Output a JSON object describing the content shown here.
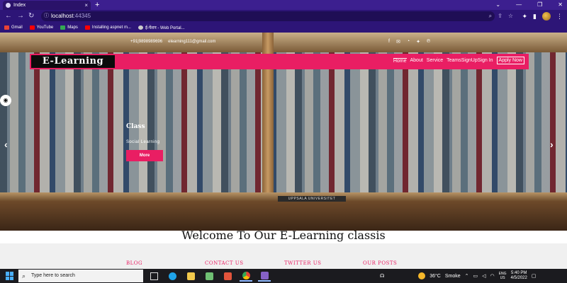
{
  "browser": {
    "tab_title": "Index",
    "tab_close": "×",
    "new_tab": "+",
    "window_controls": [
      "⌄",
      "—",
      "❐",
      "✕"
    ],
    "url_host": "localhost",
    "url_port": ":44345",
    "bookmarks": [
      {
        "label": "Gmail",
        "icon": "gmail-icon",
        "color": "#ea4335"
      },
      {
        "label": "YouTube",
        "icon": "youtube-icon",
        "color": "#ff0000"
      },
      {
        "label": "Maps",
        "icon": "maps-icon",
        "color": "#34a853"
      },
      {
        "label": "Installing aspnet m...",
        "icon": "youtube-icon",
        "color": "#ff0000"
      },
      {
        "label": "ई-पेंशन - Web Portal...",
        "icon": "portal-icon",
        "color": "#cccccc"
      }
    ]
  },
  "site": {
    "contact_phone": "+91|9898989696",
    "contact_email": "elearning111@gmail.com",
    "social_icons": [
      "facebook-icon",
      "email-icon",
      "rss-icon",
      "twitter-icon",
      "pinterest-icon"
    ],
    "brand": "E-Learning",
    "menu": [
      "Home",
      "About",
      "Service",
      "Teams",
      "SignUp",
      "Sign In"
    ],
    "apply_label": "Apply Now",
    "shelf_plate": "UPPSALA UNIVERSITET",
    "slide": {
      "title": "Class",
      "subtitle": "Social Learning",
      "button": "More"
    },
    "welcome": "Welcome To Our E-Learning classis",
    "footer_headings": [
      "BLOG",
      "CONTACT US",
      "TWITTER US",
      "OUR POSTS"
    ]
  },
  "taskbar": {
    "search_placeholder": "Type here to search",
    "apps": [
      {
        "icon": "task-view-icon",
        "color": "#dddddd"
      },
      {
        "icon": "edge-icon",
        "color": "#1fa4e9"
      },
      {
        "icon": "store-icon",
        "color": "#f2c94c"
      },
      {
        "icon": "mail-icon",
        "color": "#6fbf73"
      },
      {
        "icon": "office-icon",
        "color": "#e2543c"
      },
      {
        "icon": "chrome-icon",
        "color": "#f4b400"
      },
      {
        "icon": "visual-studio-icon",
        "color": "#8661c5"
      }
    ],
    "temperature": "36°C",
    "weather": "Smoke",
    "lang_top": "ENG",
    "lang_bottom": "US",
    "time": "5:40 PM",
    "date": "4/5/2022"
  },
  "colors": {
    "accent": "#e91e63",
    "browser_frame": "#3c1f8f"
  }
}
